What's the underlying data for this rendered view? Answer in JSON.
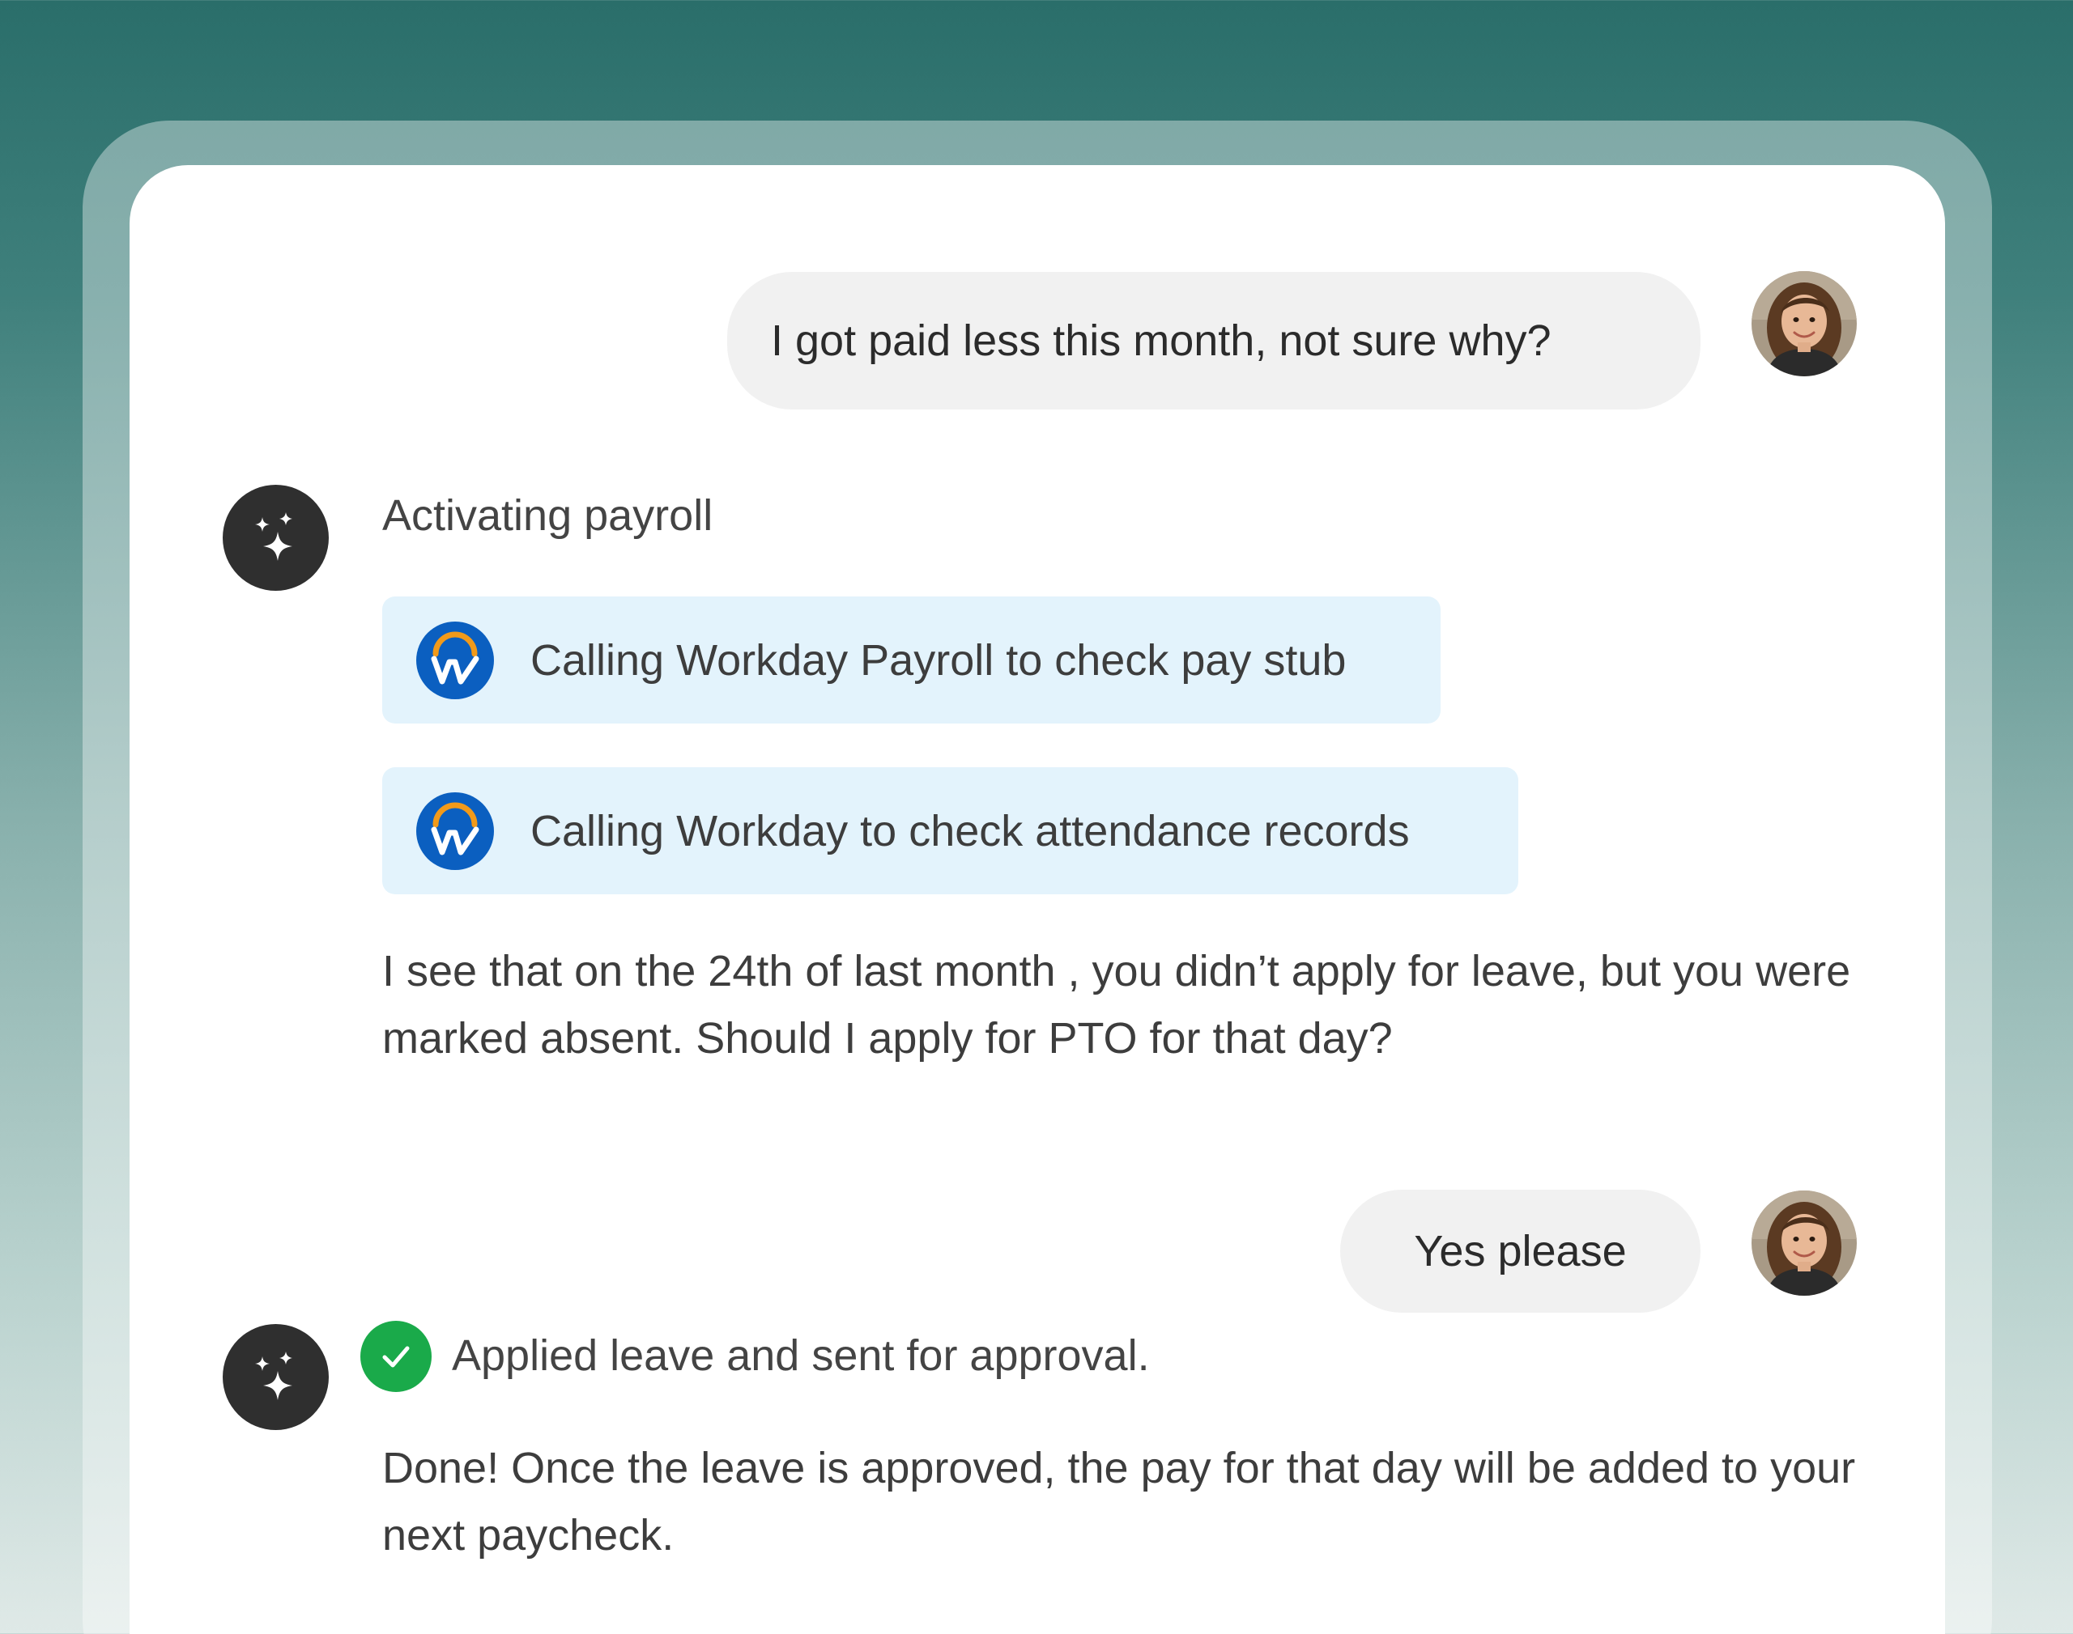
{
  "conversation": {
    "user_message_1": "I got paid less this month, not sure why?",
    "activating_label": "Activating payroll",
    "tool_call_1": "Calling Workday Payroll to check pay stub",
    "tool_call_2": "Calling Workday to check attendance records",
    "assistant_reply_1": "I see that on the 24th of last month , you didn’t apply for leave, but you were marked absent. Should I apply for PTO for that day?",
    "user_message_2": "Yes please",
    "action_status": "Applied leave and sent for approval.",
    "assistant_reply_2": "Done! Once the leave is approved, the pay for that day will be added to your next paycheck."
  },
  "icons": {
    "assistant": "sparkle-icon",
    "tool": "workday-logo-icon",
    "success": "checkmark-icon",
    "user": "user-avatar"
  },
  "colors": {
    "assistant_icon_bg": "#2f2f2f",
    "tool_chip_bg": "#e3f3fc",
    "user_bubble_bg": "#f1f1f1",
    "workday_blue": "#0b5fc0",
    "workday_orange": "#f29a1a",
    "success_green": "#1aaa4a"
  }
}
